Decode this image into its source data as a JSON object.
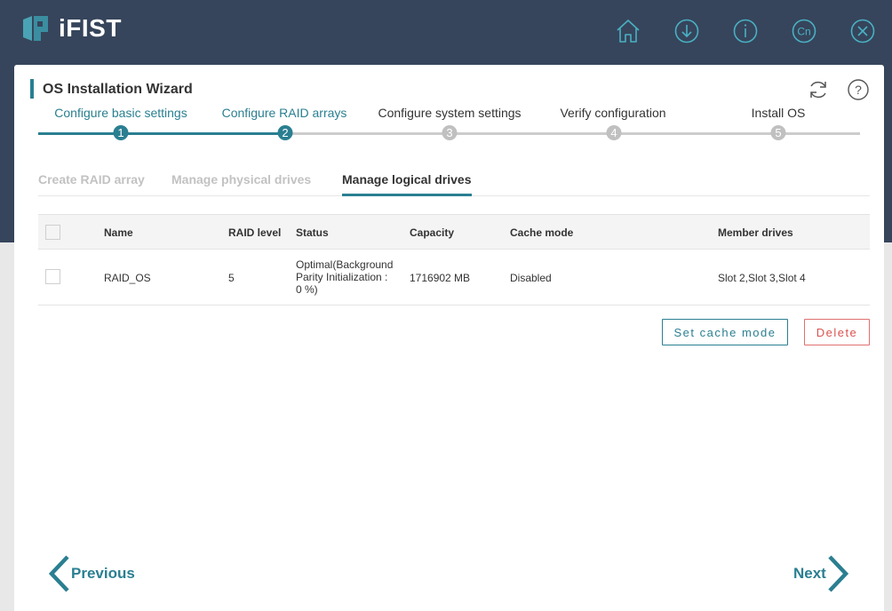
{
  "app": {
    "name": "iFIST"
  },
  "top_icons": [
    {
      "name": "home-icon",
      "label": ""
    },
    {
      "name": "download-icon",
      "label": ""
    },
    {
      "name": "info-icon",
      "label": ""
    },
    {
      "name": "language-icon",
      "label": "Cn"
    },
    {
      "name": "close-icon",
      "label": ""
    }
  ],
  "wizard": {
    "title": "OS Installation Wizard",
    "steps": [
      {
        "label": "Configure basic settings",
        "number": "1",
        "state": "done"
      },
      {
        "label": "Configure RAID arrays",
        "number": "2",
        "state": "done"
      },
      {
        "label": "Configure system settings",
        "number": "3",
        "state": "todo"
      },
      {
        "label": "Verify configuration",
        "number": "4",
        "state": "todo"
      },
      {
        "label": "Install OS",
        "number": "5",
        "state": "todo"
      }
    ]
  },
  "subtabs": [
    {
      "label": "Create RAID array",
      "active": false
    },
    {
      "label": "Manage physical drives",
      "active": false
    },
    {
      "label": "Manage logical drives",
      "active": true
    }
  ],
  "table": {
    "columns": [
      "Name",
      "RAID level",
      "Status",
      "Capacity",
      "Cache mode",
      "Member drives"
    ],
    "rows": [
      {
        "name": "RAID_OS",
        "raid_level": "5",
        "status_line1": "Optimal(Background",
        "status_line2": "Parity Initialization :",
        "status_line3": "0 %)",
        "capacity": "1716902 MB",
        "cache_mode": "Disabled",
        "member_drives": "Slot 2,Slot 3,Slot 4"
      }
    ]
  },
  "actions": {
    "set_cache_mode": "Set cache mode",
    "delete": "Delete"
  },
  "navigation": {
    "previous": "Previous",
    "next": "Next"
  },
  "colors": {
    "accent": "#2a7f91",
    "header_bg": "#36455b",
    "danger": "#d9534f"
  }
}
